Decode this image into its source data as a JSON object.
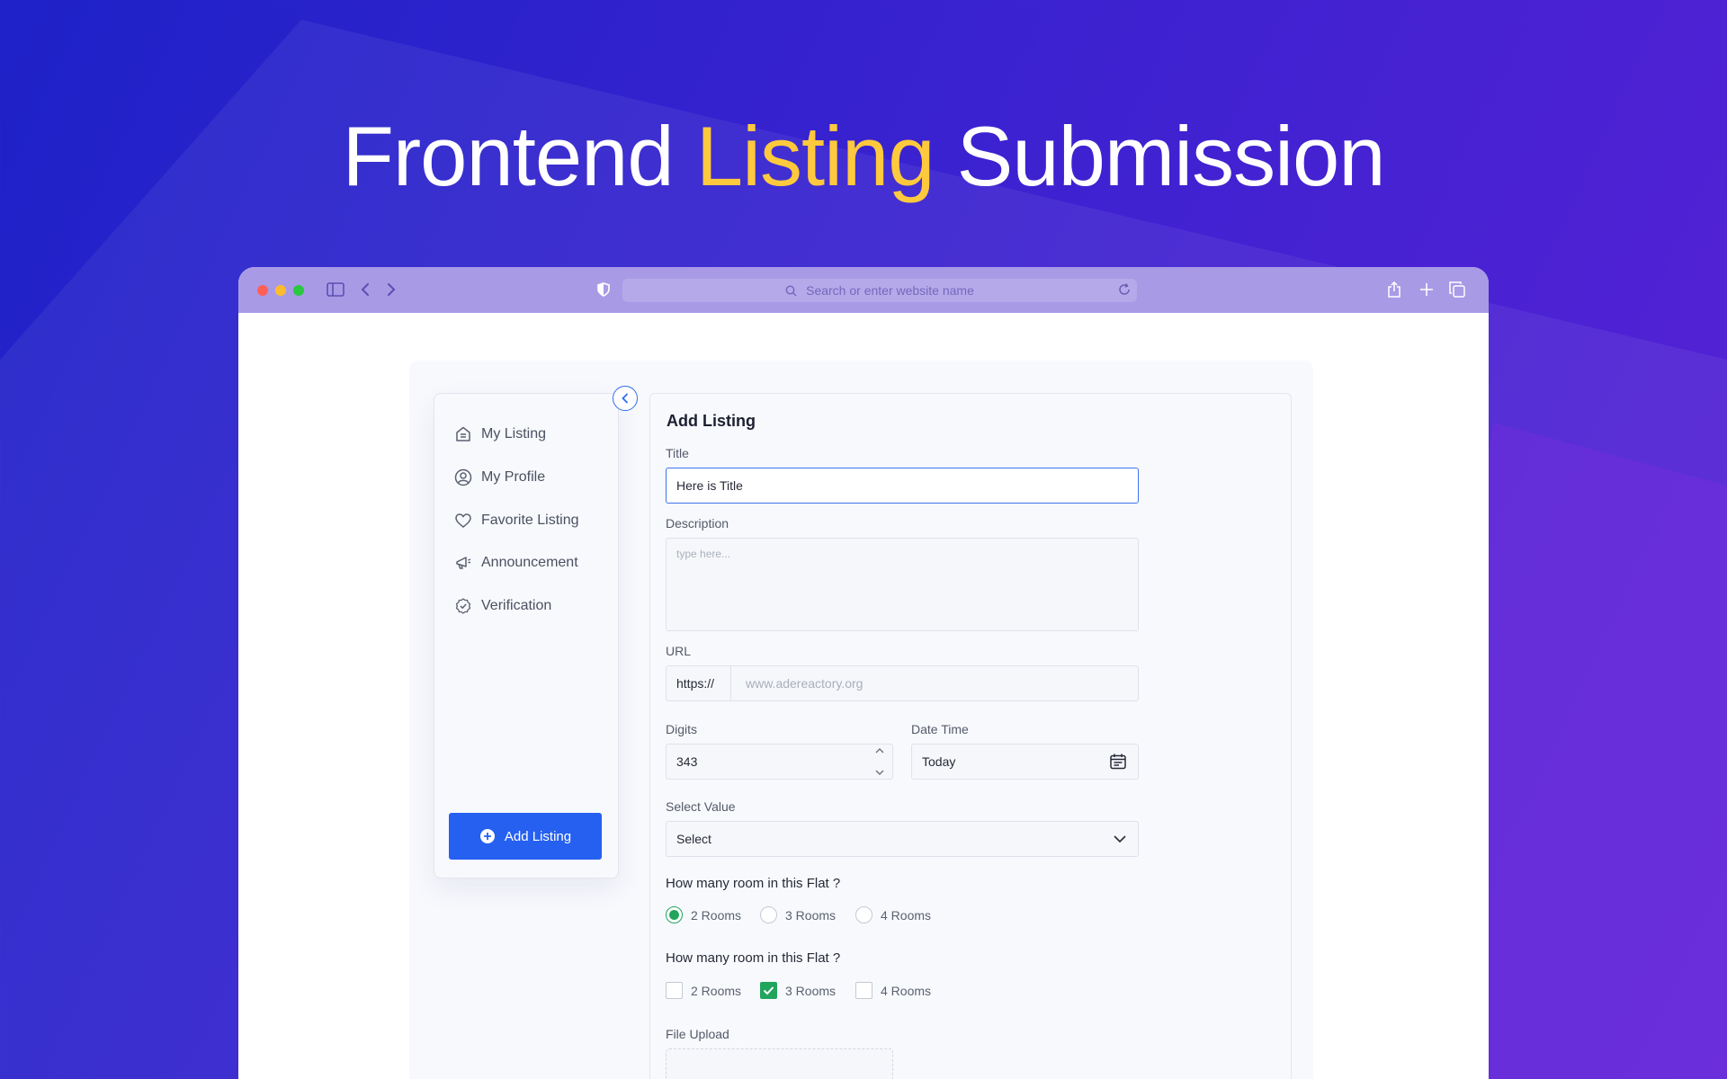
{
  "hero": {
    "prefix": "Frontend",
    "accent": "Listing",
    "suffix": "Submission"
  },
  "colors": {
    "accent": "#ffc93e",
    "primary": "#2560f0",
    "success": "#22a45d",
    "background": "#3a22d0"
  },
  "browser": {
    "address_placeholder": "Search or enter website name"
  },
  "sidebar": {
    "items": [
      {
        "label": "My Listing",
        "icon": "home-icon"
      },
      {
        "label": "My Profile",
        "icon": "user-circle-icon"
      },
      {
        "label": "Favorite Listing",
        "icon": "heart-icon"
      },
      {
        "label": "Announcement",
        "icon": "megaphone-icon"
      },
      {
        "label": "Verification",
        "icon": "badge-check-icon"
      }
    ],
    "add_button": "Add Listing"
  },
  "form": {
    "heading": "Add Listing",
    "title_label": "Title",
    "title_value": "Here is Title",
    "description_label": "Description",
    "description_placeholder": "type here...",
    "url_label": "URL",
    "url_prefix": "https://",
    "url_placeholder": "www.adereactory.org",
    "digits_label": "Digits",
    "digits_value": "343",
    "datetime_label": "Date Time",
    "datetime_value": "Today",
    "select_label": "Select Value",
    "select_value": "Select",
    "radio_question": "How many room in this Flat ?",
    "radio_options": [
      "2 Rooms",
      "3 Rooms",
      "4 Rooms"
    ],
    "radio_selected": "2 Rooms",
    "checkbox_question": "How many room in this Flat ?",
    "checkbox_options": [
      "2 Rooms",
      "3 Rooms",
      "4 Rooms"
    ],
    "checkbox_checked": [
      "3 Rooms"
    ],
    "upload_label": "File Upload"
  }
}
